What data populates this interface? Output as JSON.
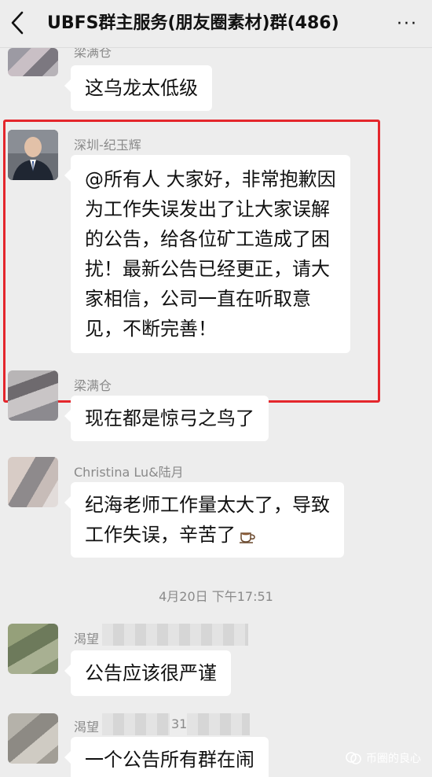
{
  "header": {
    "title": "UBFS群主服务(朋友圈素材)群(486)",
    "more_label": "···"
  },
  "messages": [
    {
      "sender": "梁满仓",
      "lines": [
        "这乌龙太低级"
      ]
    },
    {
      "sender": "深圳-纪玉辉",
      "lines": [
        "@所有人 大家好，非常抱歉因",
        "为工作失误发出了让大家误解",
        "的公告，给各位矿工造成了困",
        "扰！最新公告已经更正，请大",
        "家相信，公司一直在听取意",
        "见，不断完善！"
      ]
    },
    {
      "sender": "梁满仓",
      "lines": [
        "现在都是惊弓之鸟了"
      ]
    },
    {
      "sender": "Christina Lu&陆月",
      "lines": [
        "纪海老师工作量太大了，导致",
        "工作失误，辛苦了"
      ]
    },
    {
      "sender": "渴望",
      "lines": [
        "公告应该很严谨"
      ]
    },
    {
      "sender": "渴望",
      "sender_extra": "31",
      "lines": [
        "一个公告所有群在闹"
      ]
    }
  ],
  "timestamp": "4月20日 下午17:51",
  "watermark": "币圈的良心",
  "icons": {
    "back": "chevron-left-icon",
    "more": "more-dots-icon",
    "coffee": "coffee-icon",
    "watermark": "wechat-channel-icon"
  },
  "colors": {
    "highlight_border": "#e4262c",
    "background": "#ededed",
    "bubble": "#ffffff"
  }
}
